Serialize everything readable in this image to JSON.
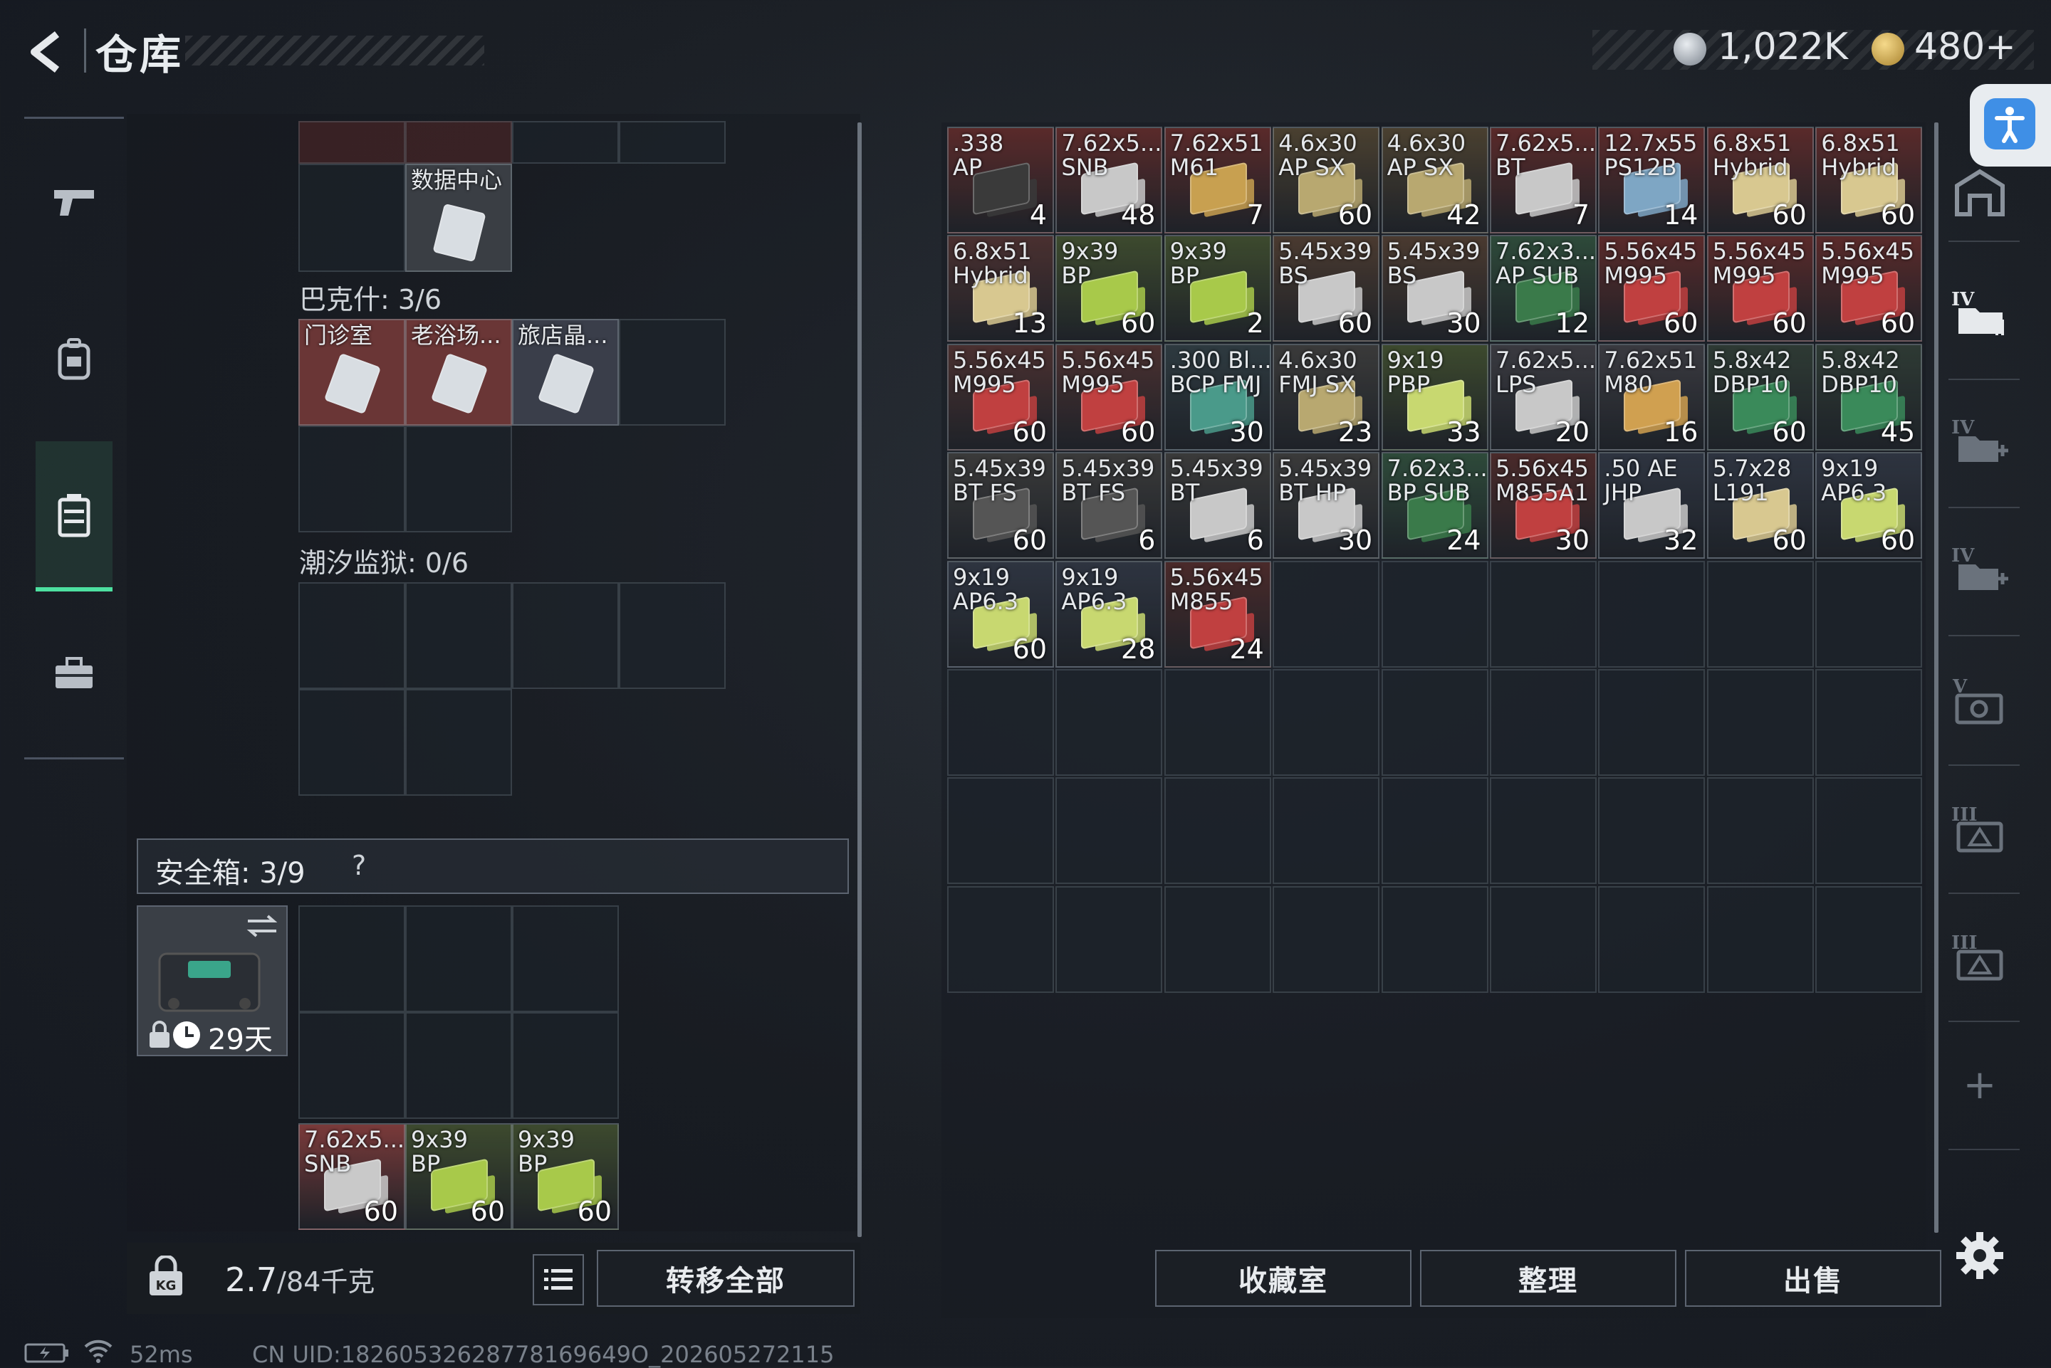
{
  "header": {
    "title": "仓库",
    "currency_silver": "1,022K",
    "currency_gold": "480+",
    "accent": "#3f8fe6"
  },
  "left_nav": {
    "items": [
      "pistol-icon",
      "backpack-icon",
      "case-icon",
      "toolbox-icon"
    ],
    "active_index": 2
  },
  "keys_panel": {
    "partial_label": "数据中心",
    "section1": {
      "label": "巴克什: 3/6",
      "items": [
        "门诊室",
        "老浴场...",
        "旅店晶..."
      ]
    },
    "section2": {
      "label": "潮汐监狱: 0/6"
    }
  },
  "safe_box": {
    "label": "安全箱: 3/9",
    "help": "?",
    "timer": "29天",
    "items": [
      {
        "name": "7.62x5...\nSNB",
        "qty": "60",
        "tint": "#7a3a3a",
        "box": "#c9c9c9"
      },
      {
        "name": "9x39\nBP",
        "qty": "60",
        "tint": "#3d4a2e",
        "box": "#a8c94a"
      },
      {
        "name": "9x39\nBP",
        "qty": "60",
        "tint": "#3d4a2e",
        "box": "#a8c94a"
      }
    ]
  },
  "footer_left": {
    "weight": "2.7",
    "weight_max": "/84千克",
    "transfer_all": "转移全部"
  },
  "status_bar": {
    "ping": "52ms",
    "uid": "CN UID:18260532628778169649O_202605272115"
  },
  "stash": {
    "items": [
      {
        "name": ".338\nAP",
        "qty": "4",
        "tint": "#5a2a2a",
        "box": "#3a3a3a"
      },
      {
        "name": "7.62x5...\nSNB",
        "qty": "48",
        "tint": "#5a2a2a",
        "box": "#c8c8c8"
      },
      {
        "name": "7.62x51\nM61",
        "qty": "7",
        "tint": "#5a2a2a",
        "box": "#c8a050"
      },
      {
        "name": "4.6x30\nAP SX",
        "qty": "60",
        "tint": "#4a4030",
        "box": "#b8a870"
      },
      {
        "name": "4.6x30\nAP SX",
        "qty": "42",
        "tint": "#4a4030",
        "box": "#b8a870"
      },
      {
        "name": "7.62x5...\nBT",
        "qty": "7",
        "tint": "#5a2a2a",
        "box": "#c8c8c8"
      },
      {
        "name": "12.7x55\nPS12B",
        "qty": "14",
        "tint": "#5a2a2a",
        "box": "#7ea6c4"
      },
      {
        "name": "6.8x51\nHybrid",
        "qty": "60",
        "tint": "#5a2a2a",
        "box": "#d8c890"
      },
      {
        "name": "6.8x51\nHybrid",
        "qty": "60",
        "tint": "#5a2a2a",
        "box": "#d8c890"
      },
      {
        "name": "6.8x51\nHybrid",
        "qty": "13",
        "tint": "#4a3030",
        "box": "#d8c890"
      },
      {
        "name": "9x39\nBP",
        "qty": "60",
        "tint": "#3d4a2e",
        "box": "#a8c94a"
      },
      {
        "name": "9x39\nBP",
        "qty": "2",
        "tint": "#3d4a2e",
        "box": "#a8c94a"
      },
      {
        "name": "5.45x39\nBS",
        "qty": "60",
        "tint": "#4a3a30",
        "box": "#c8c8c8"
      },
      {
        "name": "5.45x39\nBS",
        "qty": "30",
        "tint": "#4a3a30",
        "box": "#c8c8c8"
      },
      {
        "name": "7.62x3...\nAP SUB",
        "qty": "12",
        "tint": "#2e4a3a",
        "box": "#3a7a4a"
      },
      {
        "name": "5.56x45\nM995",
        "qty": "60",
        "tint": "#5a2a2a",
        "box": "#c04040"
      },
      {
        "name": "5.56x45\nM995",
        "qty": "60",
        "tint": "#5a2a2a",
        "box": "#c04040"
      },
      {
        "name": "5.56x45\nM995",
        "qty": "60",
        "tint": "#5a2a2a",
        "box": "#c04040"
      },
      {
        "name": "5.56x45\nM995",
        "qty": "60",
        "tint": "#4a3030",
        "box": "#c04040"
      },
      {
        "name": "5.56x45\nM995",
        "qty": "60",
        "tint": "#4a3030",
        "box": "#c04040"
      },
      {
        "name": ".300 Bl...\nBCP FMJ",
        "qty": "30",
        "tint": "#2e3a40",
        "box": "#4a9a8a"
      },
      {
        "name": "4.6x30\nFMJ SX",
        "qty": "23",
        "tint": "#3a3a3a",
        "box": "#b8a870"
      },
      {
        "name": "9x19\nPBP",
        "qty": "33",
        "tint": "#3d4a2e",
        "box": "#c8d870"
      },
      {
        "name": "7.62x5...\nLPS",
        "qty": "20",
        "tint": "#3a3a40",
        "box": "#c8c8c8"
      },
      {
        "name": "7.62x51\nM80",
        "qty": "16",
        "tint": "#3a3a40",
        "box": "#d0a050"
      },
      {
        "name": "5.8x42\nDBP10",
        "qty": "60",
        "tint": "#2e3a34",
        "box": "#3a8a5a"
      },
      {
        "name": "5.8x42\nDBP10",
        "qty": "45",
        "tint": "#2e3a34",
        "box": "#3a8a5a"
      },
      {
        "name": "5.45x39\nBT FS",
        "qty": "60",
        "tint": "#3a3a3a",
        "box": "#555555"
      },
      {
        "name": "5.45x39\nBT FS",
        "qty": "6",
        "tint": "#3a3a3a",
        "box": "#555555"
      },
      {
        "name": "5.45x39\nBT",
        "qty": "6",
        "tint": "#3a3a3a",
        "box": "#c8c8c8"
      },
      {
        "name": "5.45x39\nBT HP",
        "qty": "30",
        "tint": "#3a3a3a",
        "box": "#c8c8c8"
      },
      {
        "name": "7.62x3...\nBP SUB",
        "qty": "24",
        "tint": "#2e4a3a",
        "box": "#3a7a4a"
      },
      {
        "name": "5.56x45\nM855A1",
        "qty": "30",
        "tint": "#4a2a2a",
        "box": "#c04040"
      },
      {
        "name": ".50 AE\nJHP",
        "qty": "32",
        "tint": "#2e3440",
        "box": "#c8c8c8"
      },
      {
        "name": "5.7x28\nL191",
        "qty": "60",
        "tint": "#2e3440",
        "box": "#d8c890"
      },
      {
        "name": "9x19\nAP6.3",
        "qty": "60",
        "tint": "#2e3440",
        "box": "#c8d870"
      },
      {
        "name": "9x19\nAP6.3",
        "qty": "60",
        "tint": "#2e3440",
        "box": "#c8d870"
      },
      {
        "name": "9x19\nAP6.3",
        "qty": "28",
        "tint": "#2e3440",
        "box": "#c8d870"
      },
      {
        "name": "5.56x45\nM855",
        "qty": "24",
        "tint": "#4a2a2a",
        "box": "#c04040"
      }
    ]
  },
  "stash_footer": {
    "collection": "收藏室",
    "organize": "整理",
    "sell": "出售"
  },
  "right_rail": {
    "icons": [
      "home-icon",
      "folder-stash-icon",
      "add-tab-icon",
      "add-tab-icon-2",
      "camera-tab-icon",
      "tier-3-tab-icon",
      "tier-3-tab-icon-2",
      "plus-icon",
      "settings-icon"
    ],
    "plus": "+"
  }
}
